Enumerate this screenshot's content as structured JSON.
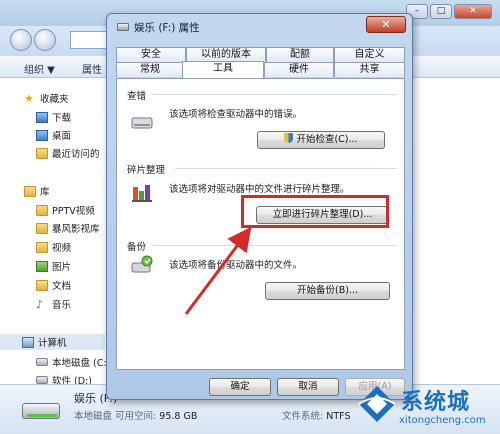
{
  "explorer": {
    "toolbar": {
      "organize": "组织 ▼",
      "properties": "属性"
    },
    "nav": {
      "favorites": "收藏夹",
      "favorites_items": [
        "下载",
        "桌面",
        "最近访问的"
      ],
      "libraries": "库",
      "library_items": [
        "PPTV视频",
        "暴风影视库",
        "视频",
        "图片",
        "文档",
        "音乐"
      ],
      "computer": "计算机",
      "computer_items": [
        "本地磁盘 (C:)",
        "软件 (D:)"
      ]
    },
    "status": {
      "drive_name": "娱乐 (F:)",
      "drive_type": "本地磁盘",
      "free_label": "可用空间:",
      "free_value": "95.8 GB",
      "fs_label": "文件系统:",
      "fs_value": "NTFS"
    }
  },
  "dialog": {
    "title": "娱乐 (F:) 属性",
    "close": "✕",
    "tabs_back": [
      "安全",
      "以前的版本",
      "配额",
      "自定义"
    ],
    "tabs_front": [
      "常规",
      "工具",
      "硬件",
      "共享"
    ],
    "active_tab": "工具",
    "groups": {
      "check": {
        "title": "查错",
        "desc": "该选项将检查驱动器中的错误。",
        "button": "开始检查(C)..."
      },
      "defrag": {
        "title": "碎片整理",
        "desc": "该选项将对驱动器中的文件进行碎片整理。",
        "button": "立即进行碎片整理(D)..."
      },
      "backup": {
        "title": "备份",
        "desc": "该选项将备份驱动器中的文件。",
        "button": "开始备份(B)..."
      }
    },
    "footer": {
      "ok": "确定",
      "cancel": "取消",
      "apply": "应用(A)"
    }
  },
  "watermark": {
    "brand": "系统城",
    "url": "xitongcheng.com"
  },
  "colors": {
    "highlight": "#d42a2a",
    "brand": "#1a6fc0"
  }
}
